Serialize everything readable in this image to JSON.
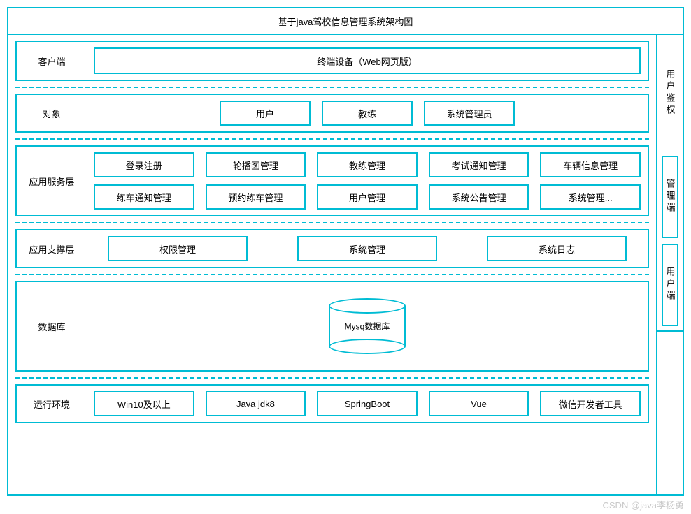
{
  "title": "基于java驾校信息管理系统架构图",
  "right": {
    "auth": "用户鉴权",
    "admin": "管理端",
    "user": "用户端"
  },
  "sections": {
    "client": {
      "label": "客户端",
      "device": "终端设备（Web网页版）"
    },
    "object": {
      "label": "对象",
      "items": [
        "用户",
        "教练",
        "系统管理员"
      ]
    },
    "app": {
      "label": "应用服务层",
      "row1": [
        "登录注册",
        "轮播图管理",
        "教练管理",
        "考试通知管理",
        "车辆信息管理"
      ],
      "row2": [
        "练车通知管理",
        "预约练车管理",
        "用户管理",
        "系统公告管理",
        "系统管理..."
      ]
    },
    "support": {
      "label": "应用支撑层",
      "items": [
        "权限管理",
        "系统管理",
        "系统日志"
      ]
    },
    "db": {
      "label": "数据库",
      "name": "Mysq数据库"
    },
    "env": {
      "label": "运行环境",
      "items": [
        "Win10及以上",
        "Java jdk8",
        "SpringBoot",
        "Vue",
        "微信开发者工具"
      ]
    }
  },
  "watermark": "CSDN @java李杨勇"
}
